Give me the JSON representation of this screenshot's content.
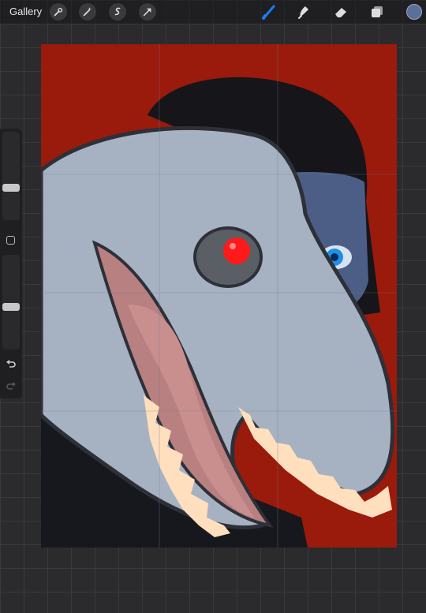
{
  "topbar": {
    "gallery_label": "Gallery",
    "left_tools": [
      "wrench-icon",
      "magic-wand-icon",
      "selection-icon",
      "transform-arrow-icon"
    ],
    "right_tools": [
      "brush-icon",
      "smudge-icon",
      "eraser-icon",
      "layers-icon"
    ],
    "active_tool": "brush-icon",
    "active_color": "#5c6f99",
    "accent_color": "#1e7bf2"
  },
  "sidebar": {
    "brush_size_level": 0.65,
    "opacity_level": 0.55,
    "buttons": [
      "modify-button",
      "undo-icon",
      "redo-icon"
    ]
  },
  "canvas": {
    "background_color": "#9a1a0b",
    "grid": true,
    "subject": "artwork-creature-with-red-eye"
  }
}
